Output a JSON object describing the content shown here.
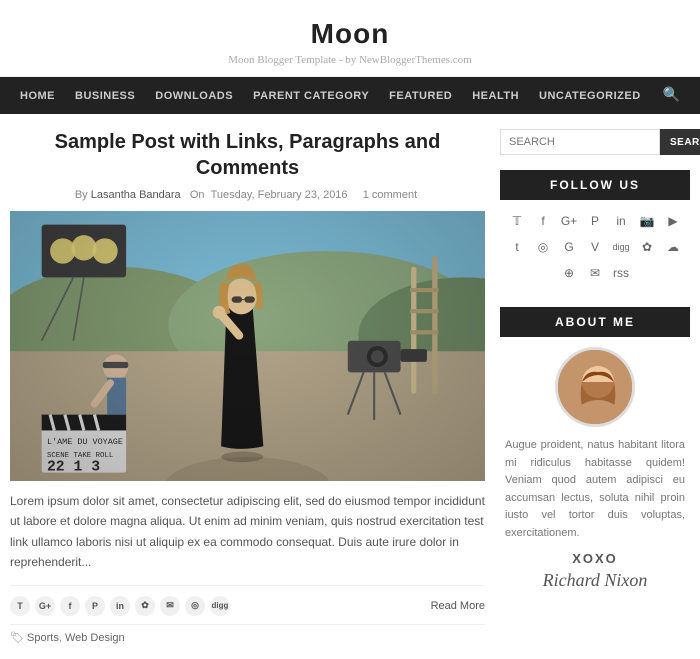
{
  "site": {
    "title": "Moon",
    "tagline": "Moon Blogger Template - by NewBloggerThemes.com"
  },
  "nav": {
    "items": [
      "HOME",
      "BUSINESS",
      "DOWNLOADS",
      "PARENT CATEGORY",
      "FEATURED",
      "HEALTH",
      "UNCATEGORIZED"
    ]
  },
  "post": {
    "title": "Sample Post with Links, Paragraphs and Comments",
    "author": "Lasantha Bandara",
    "date": "Tuesday, February 23, 2016",
    "comments": "1 comment",
    "excerpt": "Lorem ipsum dolor sit amet, consectetur adipiscing elit, sed do eiusmod tempor incididunt ut labore et dolore magna aliqua. Ut enim ad minim veniam, quis nostrud exercitation  test link ullamco laboris nisi ut aliquip ex ea commodo consequat. Duis aute irure dolor in reprehenderit...",
    "read_more": "Read More",
    "tags": "Sports, Web Design",
    "share_icons": [
      "T",
      "G+",
      "f",
      "P",
      "in",
      "✿",
      "✉",
      "◎",
      "digg"
    ]
  },
  "sidebar": {
    "search_placeholder": "SEARCH",
    "search_button": "SEARCH",
    "follow_title": "FOLLOW US",
    "about_title": "ABOUT ME",
    "about_text": "Augue proident, natus habitant litora mi ridiculus habitasse quidem! Veniam quod autem adipisci eu accumsan lectus, soluta nihil proin iusto vel tortor duis voluptas, exercitationem.",
    "about_xoxo": "XOXO",
    "about_signature": "Richard Nixon",
    "social_icons": [
      "𝕋",
      "f",
      "G+",
      "𝓟",
      "in",
      "📷",
      "▶",
      "t",
      "◎",
      "G",
      "V",
      "digg",
      "✿",
      "☁",
      "⊕",
      "✉",
      "rss",
      "✎",
      "∞"
    ]
  }
}
